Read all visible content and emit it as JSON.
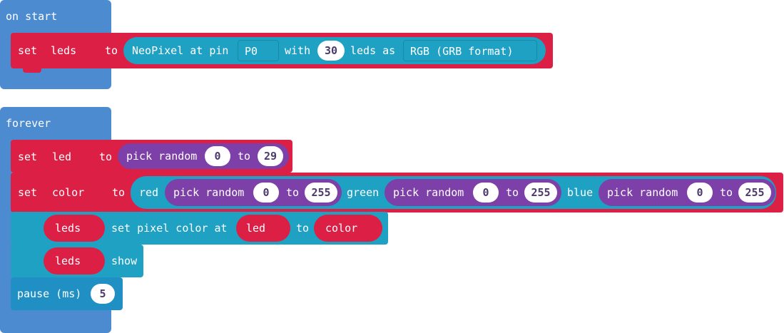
{
  "on_start": {
    "label": "on start",
    "set_kw": "set",
    "var": "leds",
    "to_kw": "to",
    "neopixel_label": "NeoPixel at pin",
    "pin": "P0",
    "with_kw": "with",
    "count": "30",
    "leds_as": "leds as",
    "format": "RGB (GRB format)"
  },
  "forever": {
    "label": "forever",
    "set_led": {
      "set_kw": "set",
      "var": "led",
      "to_kw": "to",
      "pick_random": "pick random",
      "min": "0",
      "to2": "to",
      "max": "29"
    },
    "set_color": {
      "set_kw": "set",
      "var": "color",
      "to_kw": "to",
      "red_kw": "red",
      "green_kw": "green",
      "blue_kw": "blue",
      "pick_random": "pick random",
      "min": "0",
      "to2": "to",
      "max": "255"
    },
    "set_pixel": {
      "strip": "leds",
      "label": "set pixel color at",
      "index": "led",
      "to_kw": "to",
      "color": "color"
    },
    "show": {
      "strip": "leds",
      "label": "show"
    },
    "pause": {
      "label": "pause (ms)",
      "value": "5"
    }
  }
}
